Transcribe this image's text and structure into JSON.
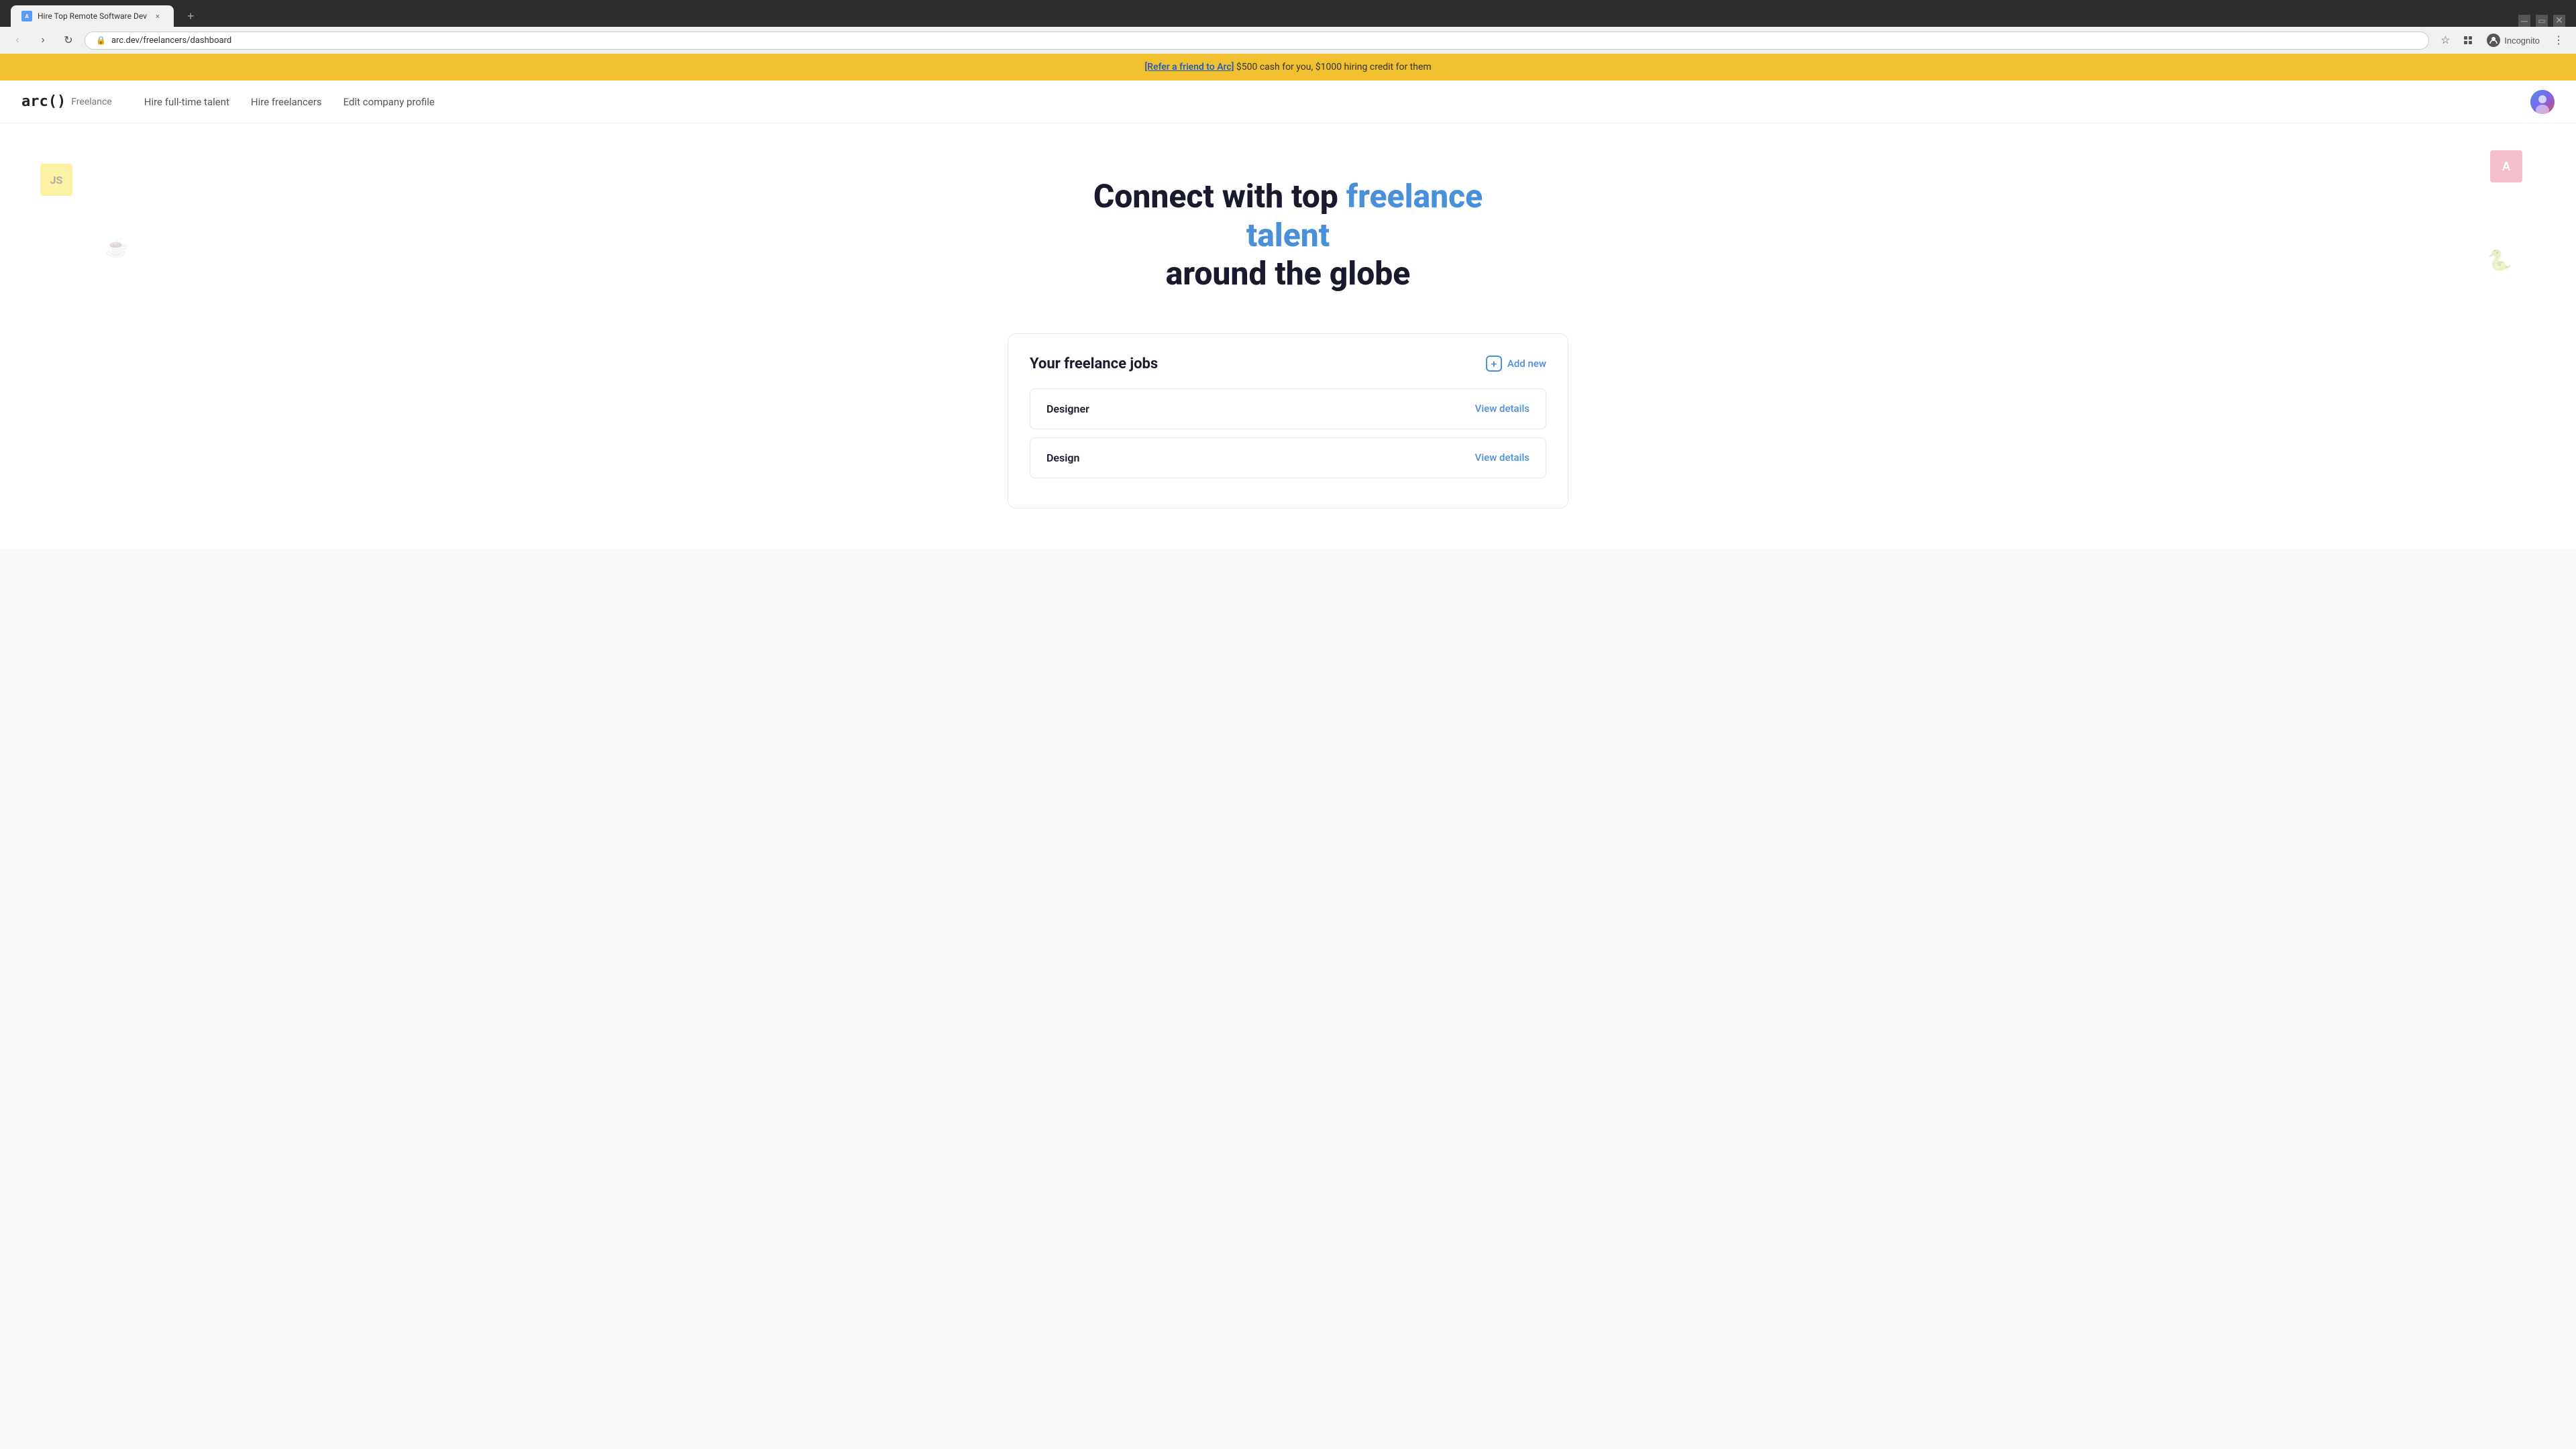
{
  "browser": {
    "tab": {
      "favicon": "A",
      "title": "Hire Top Remote Software Dev",
      "close_label": "×"
    },
    "new_tab_label": "+",
    "nav": {
      "back_label": "←",
      "forward_label": "→",
      "reload_label": "↻",
      "address": "arc.dev/freelancers/dashboard",
      "bookmark_label": "☆",
      "extensions_label": "🧩",
      "incognito_label": "Incognito",
      "menu_label": "⋮"
    }
  },
  "promo_banner": {
    "link_text": "[Refer a friend to Arc]",
    "rest_text": " $500 cash for you, $1000 hiring credit for them"
  },
  "nav": {
    "logo_mark": "arc()",
    "logo_type": "Freelance",
    "links": [
      {
        "label": "Hire full-time talent"
      },
      {
        "label": "Hire freelancers"
      },
      {
        "label": "Edit company profile"
      }
    ]
  },
  "hero": {
    "line1_plain": "Connect with top ",
    "line1_highlight": "freelance talent",
    "line2": "around the globe",
    "icons": {
      "js": "JS",
      "angular": "A",
      "java": "☕",
      "python": "🐍"
    }
  },
  "jobs": {
    "section_title": "Your freelance jobs",
    "add_new_label": "Add new",
    "items": [
      {
        "name": "Designer",
        "view_label": "View details"
      },
      {
        "name": "Design",
        "view_label": "View details"
      }
    ]
  }
}
